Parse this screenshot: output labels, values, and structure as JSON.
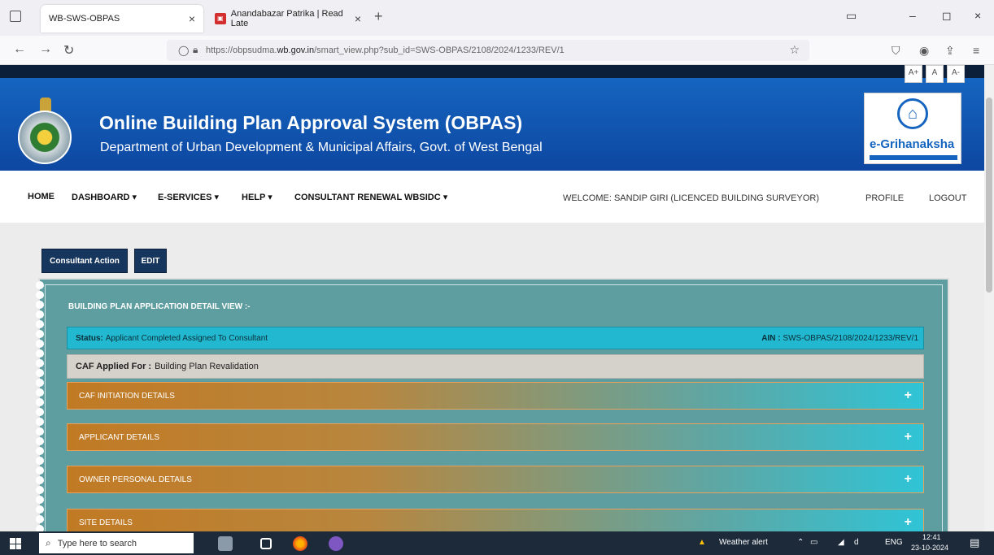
{
  "browser": {
    "tabs": [
      {
        "label": "WB-SWS-OBPAS",
        "close": "×",
        "active": true
      },
      {
        "label": "Anandabazar Patrika | Read Late",
        "close": "×",
        "active": false
      }
    ],
    "new_tab": "+",
    "url_prefix": "https://obpsudma.",
    "url_domain": "wb.gov.in",
    "url_path": "/smart_view.php?sub_id=SWS-OBPAS/2108/2024/1233/REV/1",
    "window_controls": [
      "▭",
      "–",
      "◻",
      "×"
    ]
  },
  "page": {
    "font_controls": [
      "A+",
      "A",
      "A-"
    ],
    "title": "Online Building Plan Approval System (OBPAS)",
    "subtitle": "Department of Urban Development & Municipal Affairs, Govt. of West Bengal",
    "logo_text": "e-Grihanaksha",
    "nav": [
      "HOME",
      "DASHBOARD ▾",
      "E-SERVICES ▾",
      "HELP ▾",
      "CONSULTANT RENEWAL WBSIDC ▾"
    ],
    "welcome": "WELCOME: SANDIP GIRI (LICENCED BUILDING SURVEYOR)",
    "profile": "PROFILE",
    "logout": "LOGOUT",
    "buttons": {
      "consultant_action": "Consultant Action",
      "edit": "EDIT"
    },
    "detail_title": "BUILDING PLAN APPLICATION DETAIL VIEW :-",
    "status_label": "Status:",
    "status_value": "Applicant Completed Assigned To Consultant",
    "ain_label": "AIN :",
    "ain_value": "SWS-OBPAS/2108/2024/1233/REV/1",
    "caf_label": "CAF Applied For :",
    "caf_value": "Building Plan Revalidation",
    "sections": [
      "CAF INITIATION DETAILS",
      "APPLICANT DETAILS",
      "OWNER PERSONAL DETAILS",
      "SITE DETAILS"
    ],
    "expand_symbol": "+"
  },
  "taskbar": {
    "search_placeholder": "Type here to search",
    "weather": "Weather alert",
    "lang": "ENG",
    "time": "12:41",
    "date": "23-10-2024"
  }
}
